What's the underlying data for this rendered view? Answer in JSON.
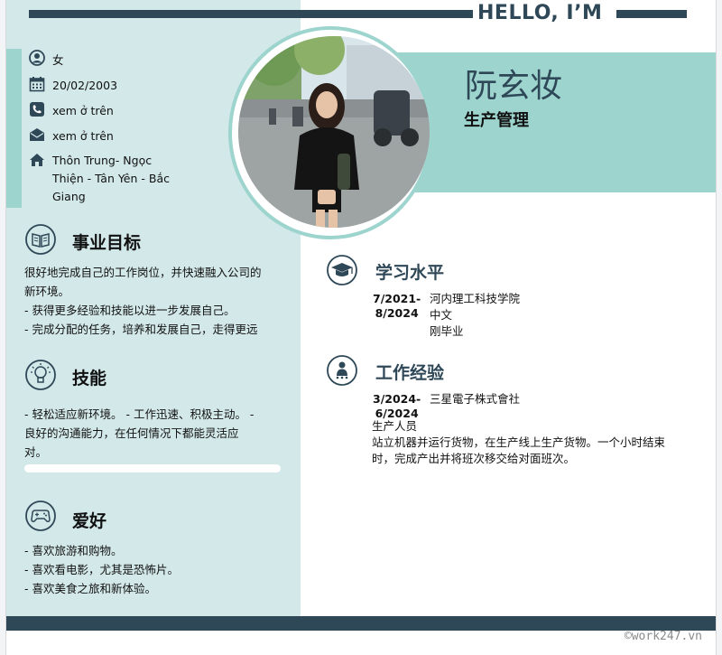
{
  "header": {
    "greeting": "HELLO, I’M"
  },
  "profile": {
    "name": "阮玄妆",
    "role": "生产管理"
  },
  "contact": {
    "gender": "女",
    "birthdate": "20/02/2003",
    "phone": "xem ở trên",
    "email": "xem ở trên",
    "address_lines": [
      "Thôn Trung- Ngọc",
      "Thiện - Tân Yên - Bắc",
      "Giang"
    ]
  },
  "career_goal": {
    "title": "事业目标",
    "lines": [
      "很好地完成自己的工作岗位，并快速融入公司的",
      "新环境。",
      "- 获得更多经验和技能以进一步发展自己。",
      " - 完成分配的任务，培养和发展自己，走得更远"
    ]
  },
  "skills": {
    "title": "技能",
    "lines": [
      "- 轻松适应新环境。 - 工作迅速、积极主动。 -",
      "良好的沟通能力，在任何情况下都能灵活应",
      "对。"
    ]
  },
  "hobbies": {
    "title": "爱好",
    "lines": [
      "- 喜欢旅游和购物。",
      "- 喜欢看电影，尤其是恐怖片。",
      " - 喜欢美食之旅和新体验。"
    ]
  },
  "education": {
    "title": "学习水平",
    "date_start": "7/2021-",
    "date_end": "8/2024",
    "lines": [
      "河内理工科技学院",
      "中文",
      "刚毕业"
    ]
  },
  "experience": {
    "title": "工作经验",
    "date_start": "3/2024-",
    "date_end": "6/2024",
    "company": "三星電子株式會社",
    "position": "生产人员",
    "desc_lines": [
      "站立机器并运行货物，在生产线上生产货物。一个小时结束",
      "时，完成产出并将班次移交给对面班次。"
    ]
  },
  "footer": {
    "watermark": "©work247.vn"
  },
  "colors": {
    "dark": "#2f4858",
    "accent": "#9dd4ce",
    "left_bg": "#d3e8e9"
  },
  "icons": [
    "user-icon",
    "calendar-icon",
    "phone-icon",
    "email-icon",
    "home-icon",
    "book-icon",
    "lightbulb-icon",
    "gamepad-icon",
    "graduation-cap-icon",
    "worker-icon"
  ]
}
